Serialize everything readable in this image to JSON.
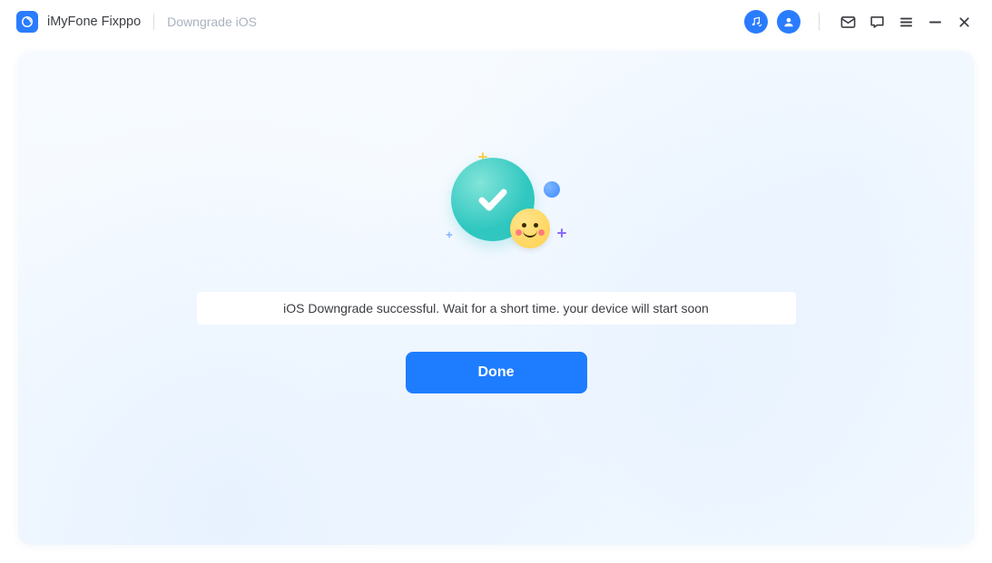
{
  "header": {
    "app_title": "iMyFone Fixppo",
    "breadcrumb": "Downgrade iOS"
  },
  "titlebar_icons": {
    "music": "music-icon",
    "account": "account-icon",
    "mail": "mail-icon",
    "feedback": "chat-icon",
    "menu": "menu-icon",
    "minimize": "minimize-icon",
    "close": "close-icon"
  },
  "main": {
    "status_message": "iOS Downgrade successful. Wait for a short time. your device will start soon",
    "done_label": "Done"
  },
  "colors": {
    "primary": "#1e7dff",
    "teal": "#2fc7c0",
    "yellow": "#ffd04d"
  }
}
